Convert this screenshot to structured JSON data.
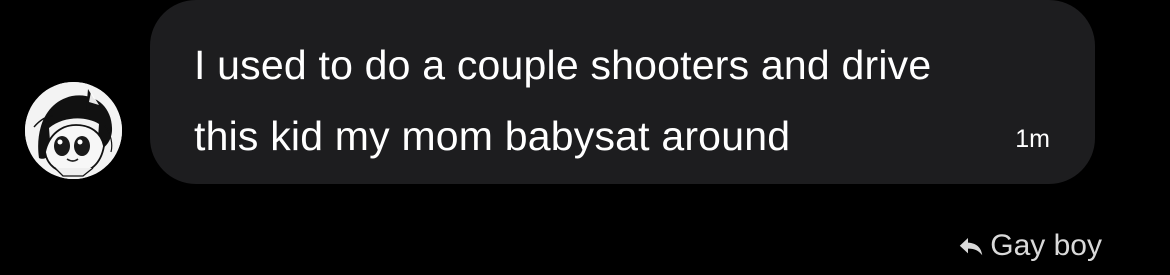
{
  "conversation": {
    "message": {
      "text": "I used to do a couple shooters and drive\nthis kid my mom babysat around",
      "time": "1m",
      "bubble_color": "#1d1d1f",
      "text_color": "#ffffff"
    },
    "sender_avatar": {
      "icon": "anime-avatar-icon"
    },
    "reply": {
      "icon": "reply-arrow-icon",
      "label": "Gay boy"
    }
  }
}
